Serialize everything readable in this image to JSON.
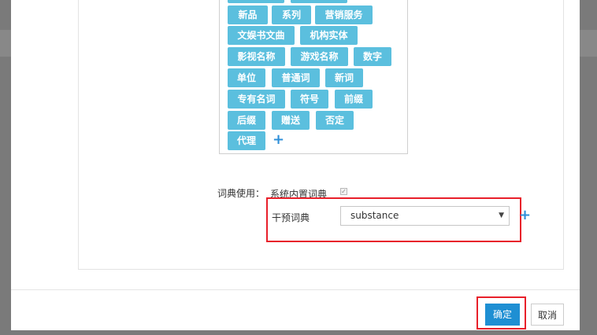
{
  "tags": {
    "items": [
      {
        "label": "新品"
      },
      {
        "label": "系列"
      },
      {
        "label": "营销服务"
      },
      {
        "label": "文娱书文曲"
      },
      {
        "label": "机构实体"
      },
      {
        "label": "影视名称"
      },
      {
        "label": "游戏名称"
      },
      {
        "label": "数字"
      },
      {
        "label": "单位"
      },
      {
        "label": "普通词"
      },
      {
        "label": "新词"
      },
      {
        "label": "专有名词"
      },
      {
        "label": "符号"
      },
      {
        "label": "前缀"
      },
      {
        "label": "后缀"
      },
      {
        "label": "赠送"
      },
      {
        "label": "否定"
      },
      {
        "label": "代理"
      }
    ],
    "add_symbol": "+"
  },
  "dictionary": {
    "usage_label": "词典使用：",
    "builtin_label": "系统内置词典",
    "builtin_checked": true,
    "intervention_label": "干预词典",
    "selected_value": "substance",
    "add_symbol": "+"
  },
  "footer": {
    "confirm_label": "确定",
    "cancel_label": "取消"
  },
  "colors": {
    "tag_bg": "#5bbfde",
    "primary_button": "#1e8fd3",
    "highlight": "#e8202a",
    "plus": "#2d8fd9"
  }
}
